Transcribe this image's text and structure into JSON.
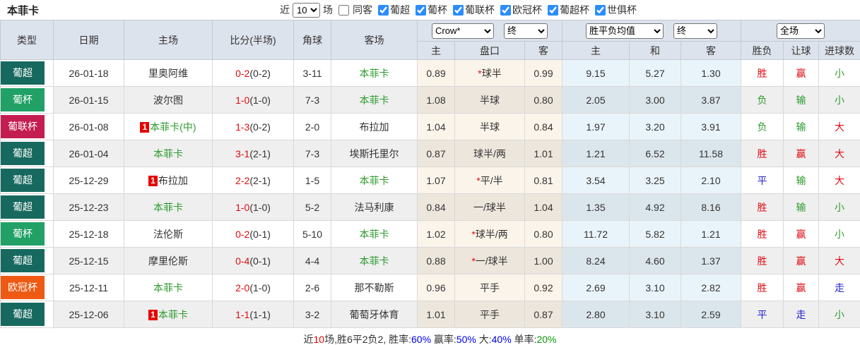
{
  "title": "本菲卡",
  "toolbar": {
    "near_label": "近",
    "count": "10",
    "games_label": "场",
    "same_away_label": "同客",
    "leagues": [
      "葡超",
      "葡杯",
      "葡联杯",
      "欧冠杯",
      "葡超杯",
      "世俱杯"
    ]
  },
  "table": {
    "columns": [
      "类型",
      "日期",
      "主场",
      "比分(半场)",
      "角球",
      "客场"
    ],
    "sub_columns": [
      "主",
      "盘口",
      "客",
      "主",
      "和",
      "客",
      "胜负",
      "让球",
      "进球数"
    ],
    "selects": {
      "provider": "Crow*",
      "provider_stage": "终",
      "avg": "胜平负均值",
      "avg_stage": "终",
      "scope": "全场"
    },
    "rows": [
      {
        "league": "葡超",
        "league_color": "#17695f",
        "date": "26-01-18",
        "home_rank": "",
        "home_name": "里奥阿维",
        "home_color": "black",
        "score_ft": "0-2",
        "score_ht": "(0-2)",
        "corners": "3-11",
        "away_rank": "",
        "away_name": "本菲卡",
        "away_color": "green",
        "odds_home": "0.89",
        "handicap_star": "*",
        "handicap": "球半",
        "odds_away": "0.99",
        "avg_home": "9.15",
        "avg_draw": "5.27",
        "avg_away": "1.30",
        "result_text": "胜",
        "result_color": "red",
        "let_text": "赢",
        "let_color": "red",
        "goal_text": "小",
        "goal_color": "green"
      },
      {
        "league": "葡杯",
        "league_color": "#21a166",
        "date": "26-01-15",
        "home_rank": "",
        "home_name": "波尔图",
        "home_color": "black",
        "score_ft": "1-0",
        "score_ht": "(1-0)",
        "corners": "7-3",
        "away_rank": "",
        "away_name": "本菲卡",
        "away_color": "green",
        "odds_home": "1.08",
        "handicap_star": "",
        "handicap": "半球",
        "odds_away": "0.80",
        "avg_home": "2.05",
        "avg_draw": "3.00",
        "avg_away": "3.87",
        "result_text": "负",
        "result_color": "green",
        "let_text": "输",
        "let_color": "green",
        "goal_text": "小",
        "goal_color": "green"
      },
      {
        "league": "葡联杯",
        "league_color": "#c41d51",
        "date": "26-01-08",
        "home_rank": "1",
        "home_name": "本菲卡(中)",
        "home_color": "green",
        "score_ft": "1-3",
        "score_ht": "(0-2)",
        "corners": "2-0",
        "away_rank": "",
        "away_name": "布拉加",
        "away_color": "black",
        "odds_home": "1.04",
        "handicap_star": "",
        "handicap": "半球",
        "odds_away": "0.84",
        "avg_home": "1.97",
        "avg_draw": "3.20",
        "avg_away": "3.91",
        "result_text": "负",
        "result_color": "green",
        "let_text": "输",
        "let_color": "green",
        "goal_text": "大",
        "goal_color": "red"
      },
      {
        "league": "葡超",
        "league_color": "#17695f",
        "date": "26-01-04",
        "home_rank": "",
        "home_name": "本菲卡",
        "home_color": "green",
        "score_ft": "3-1",
        "score_ht": "(2-1)",
        "corners": "7-3",
        "away_rank": "",
        "away_name": "埃斯托里尔",
        "away_color": "black",
        "odds_home": "0.87",
        "handicap_star": "",
        "handicap": "球半/两",
        "odds_away": "1.01",
        "avg_home": "1.21",
        "avg_draw": "6.52",
        "avg_away": "11.58",
        "result_text": "胜",
        "result_color": "red",
        "let_text": "赢",
        "let_color": "red",
        "goal_text": "大",
        "goal_color": "red"
      },
      {
        "league": "葡超",
        "league_color": "#17695f",
        "date": "25-12-29",
        "home_rank": "1",
        "home_name": "布拉加",
        "home_color": "black",
        "score_ft": "2-2",
        "score_ht": "(2-1)",
        "corners": "1-5",
        "away_rank": "",
        "away_name": "本菲卡",
        "away_color": "green",
        "odds_home": "1.07",
        "handicap_star": "*",
        "handicap": "平/半",
        "odds_away": "0.81",
        "avg_home": "3.54",
        "avg_draw": "3.25",
        "avg_away": "2.10",
        "result_text": "平",
        "result_color": "blue",
        "let_text": "输",
        "let_color": "green",
        "goal_text": "大",
        "goal_color": "red"
      },
      {
        "league": "葡超",
        "league_color": "#17695f",
        "date": "25-12-23",
        "home_rank": "",
        "home_name": "本菲卡",
        "home_color": "green",
        "score_ft": "1-0",
        "score_ht": "(1-0)",
        "corners": "5-2",
        "away_rank": "",
        "away_name": "法马利康",
        "away_color": "black",
        "odds_home": "0.84",
        "handicap_star": "",
        "handicap": "一/球半",
        "odds_away": "1.04",
        "avg_home": "1.35",
        "avg_draw": "4.92",
        "avg_away": "8.16",
        "result_text": "胜",
        "result_color": "red",
        "let_text": "输",
        "let_color": "green",
        "goal_text": "小",
        "goal_color": "green"
      },
      {
        "league": "葡杯",
        "league_color": "#21a166",
        "date": "25-12-18",
        "home_rank": "",
        "home_name": "法伦斯",
        "home_color": "black",
        "score_ft": "0-2",
        "score_ht": "(0-1)",
        "corners": "5-10",
        "away_rank": "",
        "away_name": "本菲卡",
        "away_color": "green",
        "odds_home": "1.02",
        "handicap_star": "*",
        "handicap": "球半/两",
        "odds_away": "0.80",
        "avg_home": "11.72",
        "avg_draw": "5.82",
        "avg_away": "1.21",
        "result_text": "胜",
        "result_color": "red",
        "let_text": "赢",
        "let_color": "red",
        "goal_text": "小",
        "goal_color": "green"
      },
      {
        "league": "葡超",
        "league_color": "#17695f",
        "date": "25-12-15",
        "home_rank": "",
        "home_name": "摩里伦斯",
        "home_color": "black",
        "score_ft": "0-4",
        "score_ht": "(0-1)",
        "corners": "4-4",
        "away_rank": "",
        "away_name": "本菲卡",
        "away_color": "green",
        "odds_home": "0.88",
        "handicap_star": "*",
        "handicap": "一/球半",
        "odds_away": "1.00",
        "avg_home": "8.24",
        "avg_draw": "4.60",
        "avg_away": "1.37",
        "result_text": "胜",
        "result_color": "red",
        "let_text": "赢",
        "let_color": "red",
        "goal_text": "大",
        "goal_color": "red"
      },
      {
        "league": "欧冠杯",
        "league_color": "#ee5a13",
        "date": "25-12-11",
        "home_rank": "",
        "home_name": "本菲卡",
        "home_color": "green",
        "score_ft": "2-0",
        "score_ht": "(1-0)",
        "corners": "2-6",
        "away_rank": "",
        "away_name": "那不勒斯",
        "away_color": "black",
        "odds_home": "0.96",
        "handicap_star": "",
        "handicap": "平手",
        "odds_away": "0.92",
        "avg_home": "2.69",
        "avg_draw": "3.10",
        "avg_away": "2.82",
        "result_text": "胜",
        "result_color": "red",
        "let_text": "赢",
        "let_color": "red",
        "goal_text": "走",
        "goal_color": "blue"
      },
      {
        "league": "葡超",
        "league_color": "#17695f",
        "date": "25-12-06",
        "home_rank": "1",
        "home_name": "本菲卡",
        "home_color": "green",
        "score_ft": "1-1",
        "score_ht": "(1-1)",
        "corners": "3-2",
        "away_rank": "",
        "away_name": "葡萄牙体育",
        "away_color": "black",
        "odds_home": "1.01",
        "handicap_star": "",
        "handicap": "平手",
        "odds_away": "0.87",
        "avg_home": "2.80",
        "avg_draw": "3.10",
        "avg_away": "2.59",
        "result_text": "平",
        "result_color": "blue",
        "let_text": "走",
        "let_color": "blue",
        "goal_text": "小",
        "goal_color": "green"
      }
    ]
  },
  "summary": {
    "segments": [
      {
        "text": "近",
        "color": "black"
      },
      {
        "text": "10",
        "color": "red"
      },
      {
        "text": "场,胜6平2负2, 胜率:",
        "color": "black"
      },
      {
        "text": "60%",
        "color": "blue"
      },
      {
        "text": " 赢率:",
        "color": "black"
      },
      {
        "text": "50%",
        "color": "blue"
      },
      {
        "text": " 大:",
        "color": "black"
      },
      {
        "text": "40%",
        "color": "blue"
      },
      {
        "text": " 单率:",
        "color": "black"
      },
      {
        "text": "20%",
        "color": "green"
      }
    ]
  }
}
